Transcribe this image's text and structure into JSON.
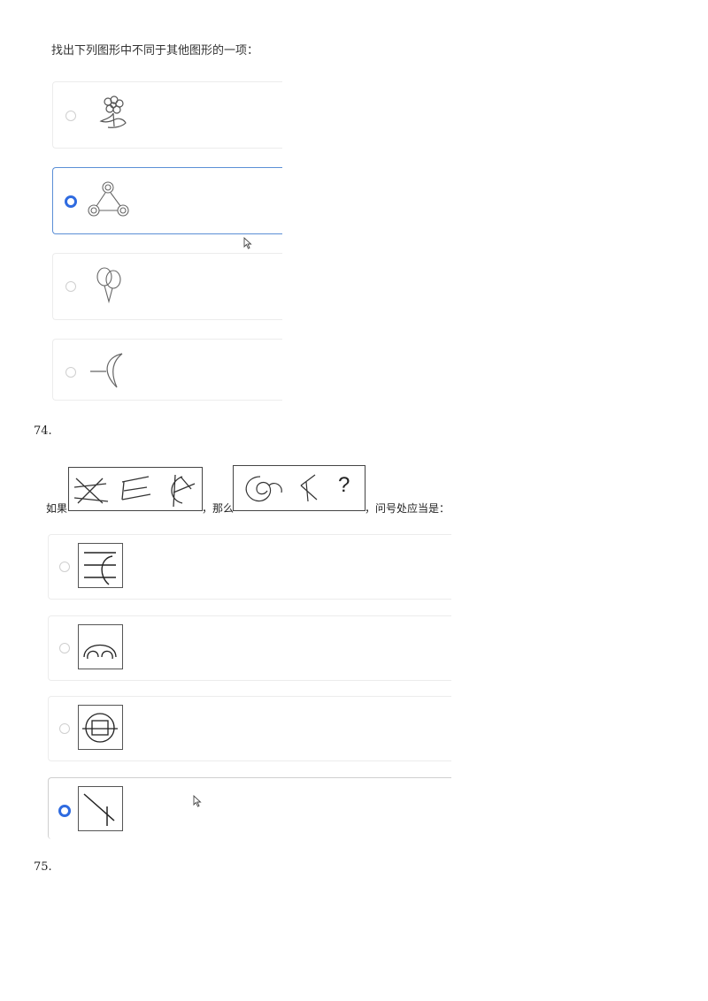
{
  "q73": {
    "prompt": "找出下列图形中不同于其他图形的一项：",
    "options": [
      {
        "figure": "flower-doodle-icon",
        "selected": false
      },
      {
        "figure": "three-circle-triangle-icon",
        "selected": true
      },
      {
        "figure": "balloons-icon",
        "selected": false
      },
      {
        "figure": "crescent-arc-icon",
        "selected": false
      }
    ]
  },
  "q74": {
    "number": "74.",
    "prompt_prefix": "如果",
    "prompt_middle": "，那么",
    "prompt_suffix": "，问号处应当是：",
    "question_mark": "?",
    "options": [
      {
        "figure": "lines-with-arc-icon",
        "selected": false
      },
      {
        "figure": "double-arch-icon",
        "selected": false
      },
      {
        "figure": "circle-with-rect-icon",
        "selected": false
      },
      {
        "figure": "diagonal-lines-icon",
        "selected": true
      }
    ]
  },
  "q75": {
    "number": "75."
  }
}
